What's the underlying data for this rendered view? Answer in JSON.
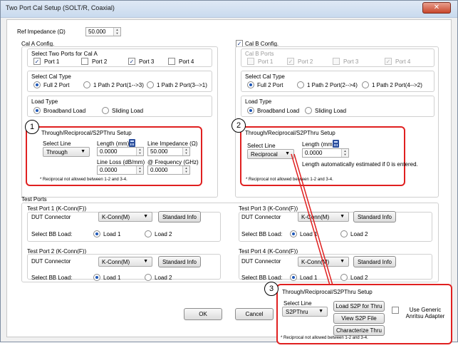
{
  "window": {
    "title": "Two Port Cal Setup (SOLT/R, Coaxial)",
    "close_glyph": "✕"
  },
  "ref_impedance": {
    "label": "Ref Impedance (Ω)",
    "value": "50.000"
  },
  "cal_a": {
    "group_label": "Cal A Config.",
    "ports_label": "Select Two Ports for Cal A",
    "ports": [
      {
        "label": "Port 1",
        "checked": true
      },
      {
        "label": "Port 2",
        "checked": false
      },
      {
        "label": "Port 3",
        "checked": true
      },
      {
        "label": "Port 4",
        "checked": false
      }
    ],
    "cal_type_label": "Select Cal Type",
    "cal_types": [
      "Full 2 Port",
      "1 Path 2 Port(1-->3)",
      "1 Path 2 Port(3-->1)"
    ],
    "load_type_label": "Load Type",
    "load_types": [
      "Broadband Load",
      "Sliding Load"
    ]
  },
  "cal_b": {
    "group_label": "Cal B Config.",
    "checked": true,
    "ports_label": "Cal B Ports",
    "ports": [
      {
        "label": "Port 1",
        "checked": false
      },
      {
        "label": "Port 2",
        "checked": true
      },
      {
        "label": "Port 3",
        "checked": false
      },
      {
        "label": "Port 4",
        "checked": true
      }
    ],
    "cal_type_label": "Select Cal Type",
    "cal_types": [
      "Full 2 Port",
      "1 Path 2 Port(2-->4)",
      "1 Path 2 Port(4-->2)"
    ],
    "load_type_label": "Load Type",
    "load_types": [
      "Broadband Load",
      "Sliding Load"
    ]
  },
  "thru_a": {
    "callout": "1",
    "title": "Through/Reciprocal/S2PThru Setup",
    "select_line_label": "Select Line",
    "select_line_value": "Through",
    "length_label": "Length (mm)",
    "length_value": "0.0000",
    "line_impedance_label": "Line Impedance (Ω)",
    "line_impedance_value": "50.000",
    "line_loss_label": "Line Loss (dB/mm)",
    "line_loss_value": "0.0000",
    "frequency_label": "@ Frequency (GHz)",
    "frequency_value": "0.0000",
    "note": "* Reciprocal not allowed between 1-2 and 3-4."
  },
  "thru_b": {
    "callout": "2",
    "title": "Through/Reciprocal/S2PThru Setup",
    "select_line_label": "Select Line",
    "select_line_value": "Reciprocal",
    "length_label": "Length (mm)",
    "length_value": "0.0000",
    "auto_note": "Length automatically estimated if 0 is entered.",
    "note": "* Reciprocal not allowed between 1-2 and 3-4."
  },
  "test_ports": {
    "group_label": "Test Ports",
    "dut_label": "DUT Connector",
    "bb_label": "Select BB Load:",
    "standard_info_label": "Standard Info",
    "ports": [
      {
        "title": "Test Port 1 (K-Conn(F))",
        "connector": "K-Conn(M)",
        "load1": "Load 1",
        "load2": "Load 2"
      },
      {
        "title": "Test Port 3 (K-Conn(F))",
        "connector": "K-Conn(M)",
        "load1": "Load 1",
        "load2": "Load 2"
      },
      {
        "title": "Test Port 2 (K-Conn(F))",
        "connector": "K-Conn(M)",
        "load1": "Load 1",
        "load2": "Load 2"
      },
      {
        "title": "Test Port 4 (K-Conn(F))",
        "connector": "K-Conn(M)",
        "load1": "Load 1",
        "load2": "Load 2"
      }
    ]
  },
  "footer": {
    "ok_label": "OK",
    "cancel_label": "Cancel"
  },
  "thru_c": {
    "callout": "3",
    "title": "Through/Reciprocal/S2PThru Setup",
    "select_line_label": "Select Line",
    "select_line_value": "S2PThru",
    "load_s2p_label": "Load S2P for Thru",
    "view_s2p_label": "View S2P File",
    "characterize_label": "Characterize Thru",
    "generic_adapter_label": "Use Generic Anritsu Adapter",
    "note": "* Reciprocal not allowed between 1-2 and 3-4."
  },
  "colors": {
    "highlight_red": "#e02020",
    "accent_blue": "#1d57b8"
  },
  "icons": {
    "calculator": "calculator-icon",
    "spin": "spin-arrows-icon",
    "dropdown": "chevron-down-icon"
  }
}
